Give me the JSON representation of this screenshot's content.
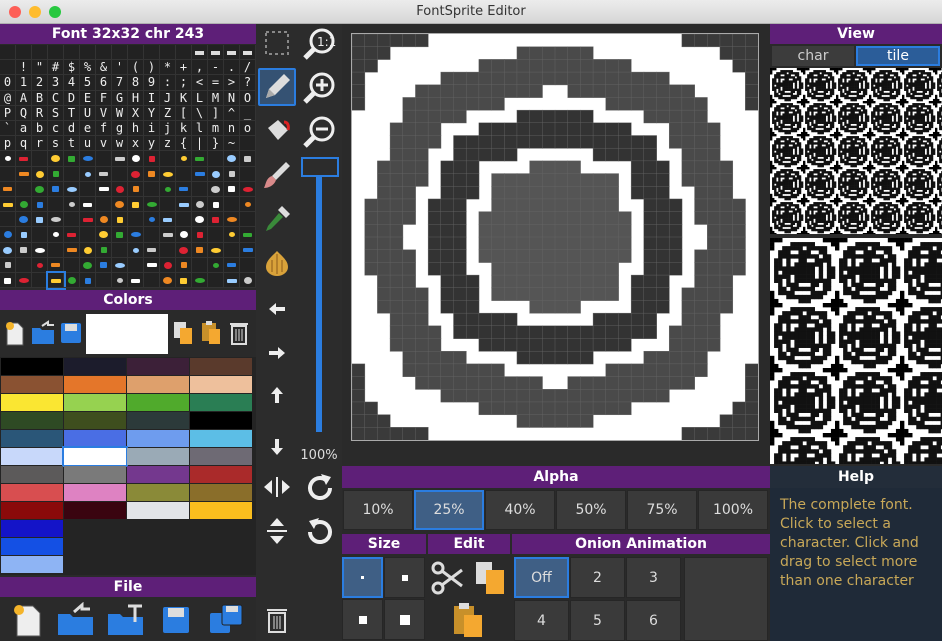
{
  "window": {
    "title": "FontSprite Editor"
  },
  "font_panel": {
    "header": "Font 32x32  chr 243"
  },
  "colors_panel": {
    "header": "Colors"
  },
  "file_panel": {
    "header": "File"
  },
  "zoom": {
    "label": "100%",
    "level": 1.0
  },
  "view_panel": {
    "header": "View",
    "tabs": [
      "char",
      "tile"
    ],
    "selected_tab": "tile"
  },
  "help_panel": {
    "header": "Help",
    "text": "The complete font. Click to select a character. Click and drag to select more than one character"
  },
  "alpha_panel": {
    "header": "Alpha",
    "options": [
      "10%",
      "25%",
      "40%",
      "50%",
      "75%",
      "100%"
    ],
    "selected": "25%"
  },
  "size_panel": {
    "header": "Size"
  },
  "edit_panel": {
    "header": "Edit"
  },
  "onion_panel": {
    "header": "Onion Animation",
    "options": [
      "Off",
      "2",
      "3",
      "4",
      "5",
      "6"
    ],
    "selected": "Off"
  },
  "font_rows": [
    " !\"#$%&'()*+,-./",
    "0123456789:;<=>?",
    "@ABCDEFGHIJKLMNO",
    "PQRSTUVWXYZ[\\]^_",
    "`abcdefghijklmno",
    "pqrstuvwxyz{|}~"
  ],
  "palette": [
    [
      "#000000",
      "#1c1c2c",
      "#3c2038",
      "#5a3a2c"
    ],
    [
      "#8a5232",
      "#e4762a",
      "#dea06c",
      "#eec09c"
    ],
    [
      "#fae632",
      "#96d250",
      "#50aa2c",
      "#2a7e54"
    ],
    [
      "#2e4a24",
      "#3e4e1e",
      "#2c3a3a",
      "#000000"
    ],
    [
      "#2a5678",
      "#4a6ee4",
      "#6e9cee",
      "#5cbee6"
    ],
    [
      "#c8d8fa",
      "#ffffff",
      "#9aaab6",
      "#6e6a74"
    ],
    [
      "#5c5a5a",
      "#7a7a7a",
      "#74388e",
      "#aa2a2a"
    ],
    [
      "#d84e50",
      "#de82c2",
      "#8a8a38",
      "#8a6e2a"
    ],
    [
      "#8a0a0a",
      "#3a0410",
      "#e2e4e8",
      "#fabe1e"
    ],
    [
      "#1414c8",
      "",
      "",
      ""
    ],
    [
      "#1450e4",
      "",
      "",
      ""
    ],
    [
      "#8eb4f4",
      "",
      "",
      ""
    ]
  ],
  "colors": {
    "current": "#ffffff",
    "accent": "#2b7de0",
    "panel_header": "#5e1f78",
    "selection": "#2b7de0"
  }
}
